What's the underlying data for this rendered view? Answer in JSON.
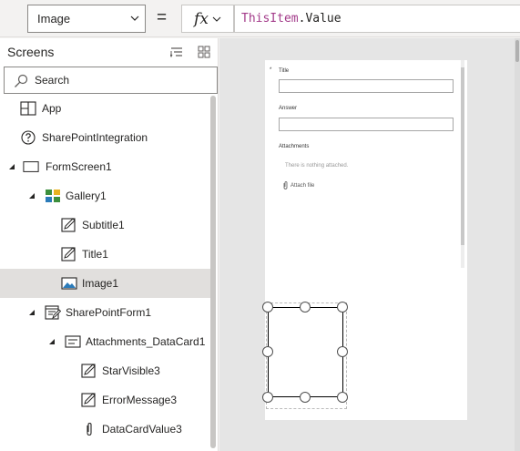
{
  "formula_bar": {
    "property": "Image",
    "equals": "=",
    "fx_label": "fx",
    "formula_fn": "ThisItem",
    "formula_rest": ".Value"
  },
  "tree": {
    "header": "Screens",
    "search_placeholder": "Search",
    "items": [
      {
        "label": "App",
        "icon": "app-icon"
      },
      {
        "label": "SharePointIntegration",
        "icon": "help-circle-icon"
      },
      {
        "label": "FormScreen1",
        "icon": "screen-icon",
        "expanded": true
      },
      {
        "label": "Gallery1",
        "icon": "gallery-icon",
        "expanded": true
      },
      {
        "label": "Subtitle1",
        "icon": "edit-label-icon"
      },
      {
        "label": "Title1",
        "icon": "edit-label-icon"
      },
      {
        "label": "Image1",
        "icon": "image-icon",
        "selected": true
      },
      {
        "label": "SharePointForm1",
        "icon": "form-icon",
        "expanded": true
      },
      {
        "label": "Attachments_DataCard1",
        "icon": "datacard-icon",
        "expanded": true
      },
      {
        "label": "StarVisible3",
        "icon": "edit-label-icon"
      },
      {
        "label": "ErrorMessage3",
        "icon": "edit-label-icon"
      },
      {
        "label": "DataCardValue3",
        "icon": "paperclip-icon"
      }
    ]
  },
  "form": {
    "asterisk": "*",
    "title_label": "Title",
    "answer_label": "Answer",
    "attachments_label": "Attachments",
    "no_attachments": "There is nothing attached.",
    "attach_file": "Attach file"
  },
  "colors": {
    "formula_function": "#a33b8a",
    "selected_row": "#e1dfdd",
    "canvas_bg": "#e5e5e5"
  }
}
